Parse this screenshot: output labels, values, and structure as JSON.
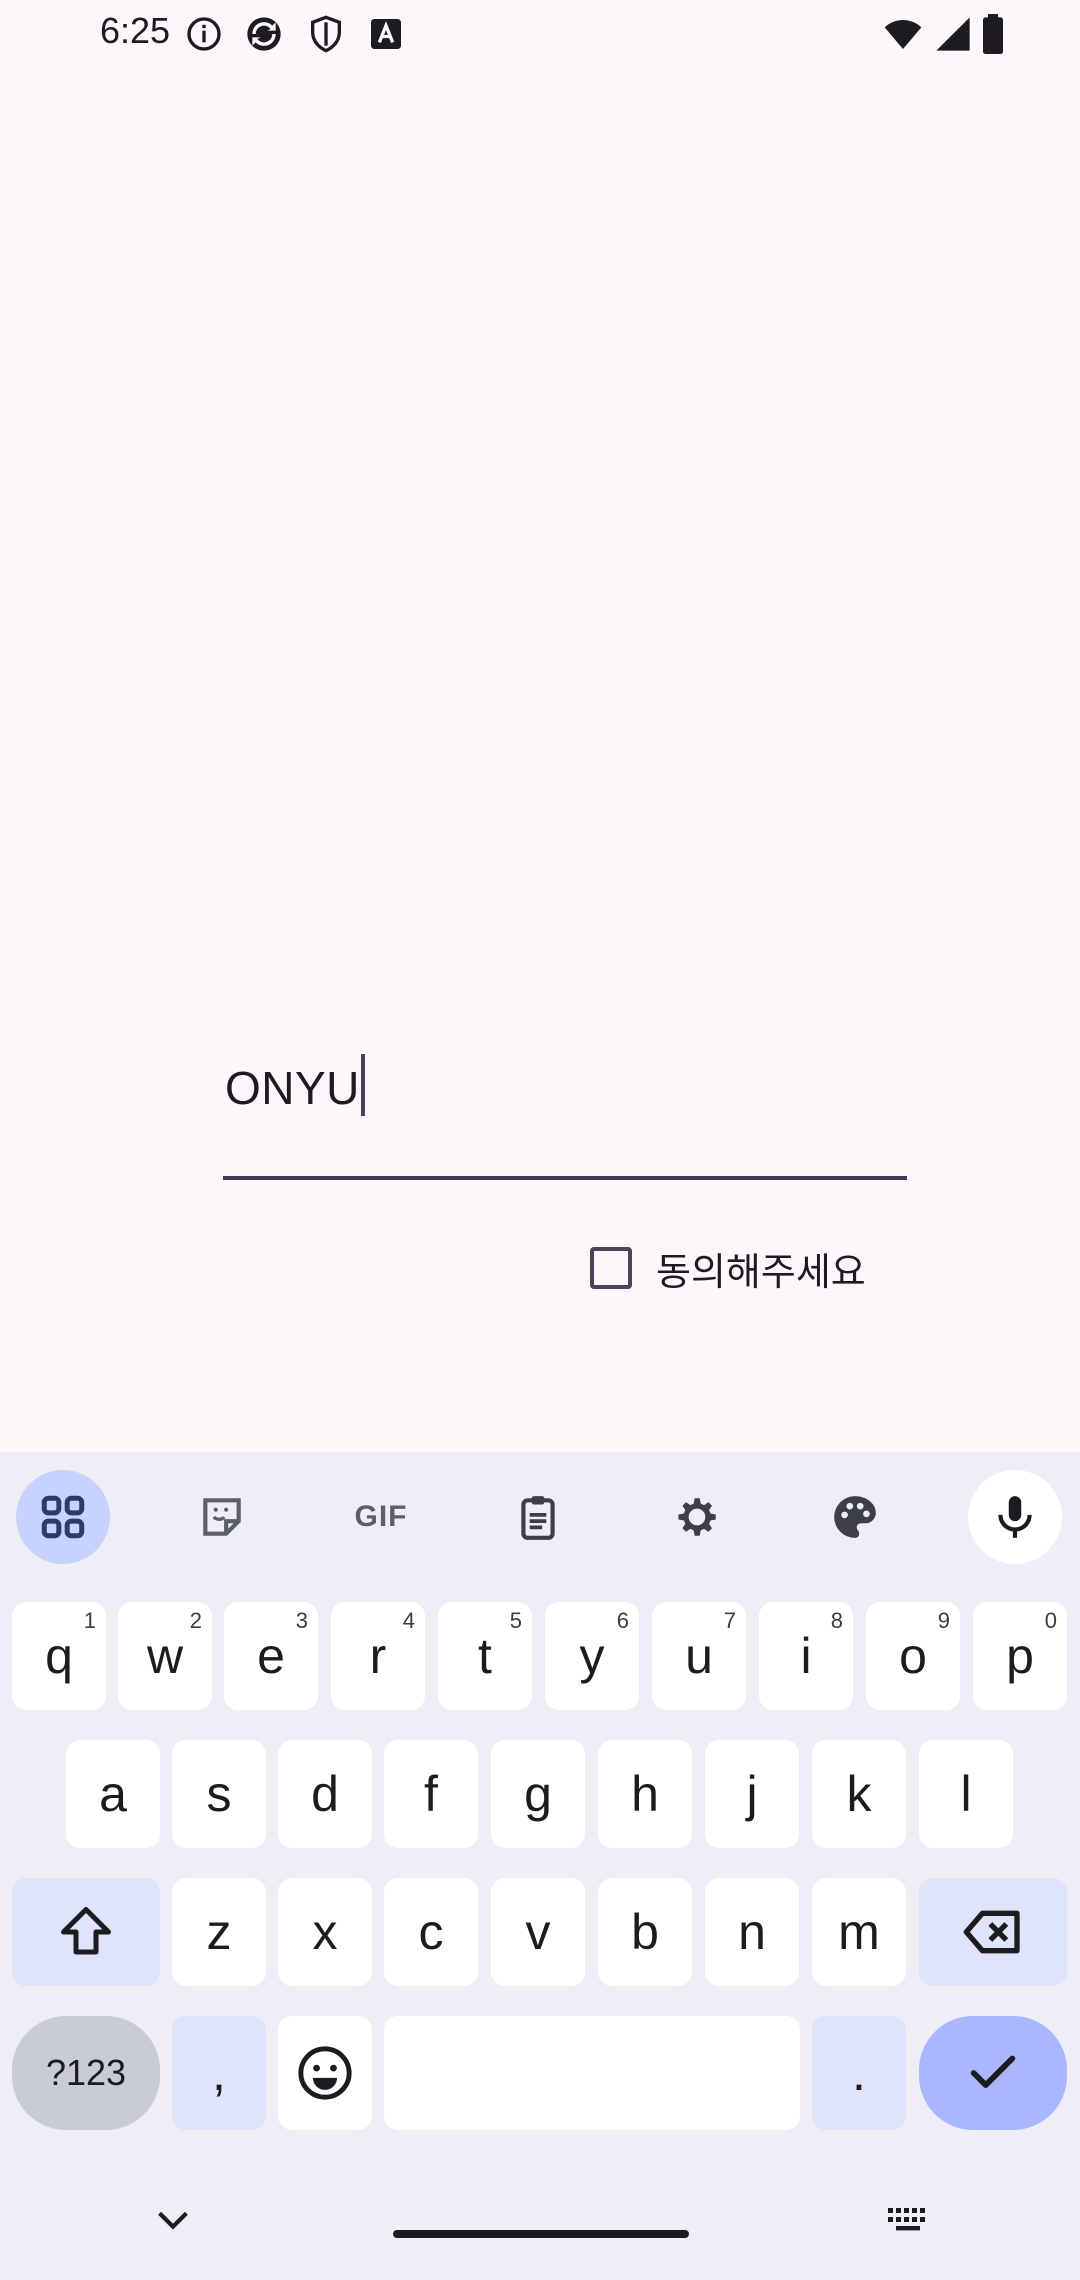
{
  "status_bar": {
    "time": "6:25",
    "left_icons": [
      "info-icon",
      "sync-icon",
      "shield-icon",
      "font-a-icon"
    ],
    "right_icons": [
      "wifi-icon",
      "signal-icon",
      "battery-icon"
    ]
  },
  "form": {
    "text_value": "ONYU",
    "checkbox_label": "동의해주세요",
    "checkbox_checked": false
  },
  "keyboard": {
    "toolbar": [
      "apps-grid-icon",
      "sticker-icon",
      "GIF",
      "clipboard-icon",
      "settings-icon",
      "palette-icon",
      "mic-icon"
    ],
    "gif_label": "GIF",
    "row1": [
      {
        "k": "q",
        "h": "1"
      },
      {
        "k": "w",
        "h": "2"
      },
      {
        "k": "e",
        "h": "3"
      },
      {
        "k": "r",
        "h": "4"
      },
      {
        "k": "t",
        "h": "5"
      },
      {
        "k": "y",
        "h": "6"
      },
      {
        "k": "u",
        "h": "7"
      },
      {
        "k": "i",
        "h": "8"
      },
      {
        "k": "o",
        "h": "9"
      },
      {
        "k": "p",
        "h": "0"
      }
    ],
    "row2": [
      "a",
      "s",
      "d",
      "f",
      "g",
      "h",
      "j",
      "k",
      "l"
    ],
    "row3": [
      "z",
      "x",
      "c",
      "v",
      "b",
      "n",
      "m"
    ],
    "sym_label": "?123",
    "comma_label": ",",
    "period_label": ".",
    "colors": {
      "background": "#efedf5",
      "key": "#ffffff",
      "function_key": "#dfe4fb",
      "accent": "#a8b7ff"
    }
  }
}
